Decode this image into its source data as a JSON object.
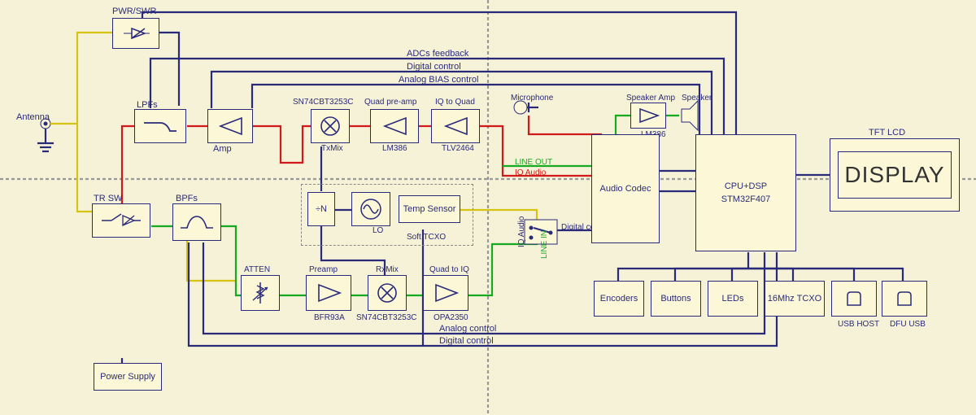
{
  "blocks": {
    "pwr_swr": "PWR/SWR",
    "antenna": "Antenna",
    "lpfs": "LPFs",
    "amp": "Amp",
    "txmix_top": "SN74CBT3253C",
    "txmix_sub": "TxMix",
    "quad_preamp": "Quad pre-amp",
    "quad_pre_sub": "LM386",
    "iq_to_quad": "IQ to Quad",
    "iq_to_quad_sub": "TLV2464",
    "tr_sw": "TR SW",
    "bpfs": "BPFs",
    "divn": "÷N",
    "lo": "LO",
    "soft_tcxo": "Soft TCXO",
    "temp_sensor": "Temp Sensor",
    "atten": "ATTEN",
    "preamp": "Preamp",
    "preamp_sub": "BFR93A",
    "rxmix": "RxMix",
    "rxmix_sub": "SN74CBT3253C",
    "quad_to_iq": "Quad to IQ",
    "quad_to_iq_sub": "OPA2350",
    "power_supply": "Power Supply",
    "microphone": "Microphone",
    "speaker_amp": "Speaker Amp",
    "speaker_amp_sub": "LM386",
    "speaker": "Speaker",
    "line_out": "LINE OUT",
    "iq_audio_1": "IQ Audio",
    "iq_audio_2": "IQ Audio",
    "line_in": "LINE IN",
    "digital_control_mid": "Digital control",
    "audio_codec": "Audio Codec",
    "cpu_dsp": "CPU+DSP",
    "cpu_dsp_sub": "STM32F407",
    "tft_lcd": "TFT LCD",
    "display": "DISPLAY",
    "encoders": "Encoders",
    "buttons": "Buttons",
    "leds": "LEDs",
    "tcxo_16": "16Mhz TCXO",
    "usb_host": "USB HOST",
    "dfu_usb": "DFU USB",
    "adcs_feedback": "ADCs feedback",
    "digital_control_top": "Digital control",
    "analog_bias": "Analog BIAS control",
    "analog_control_bot": "Analog control",
    "digital_control_bot": "Digital control"
  }
}
